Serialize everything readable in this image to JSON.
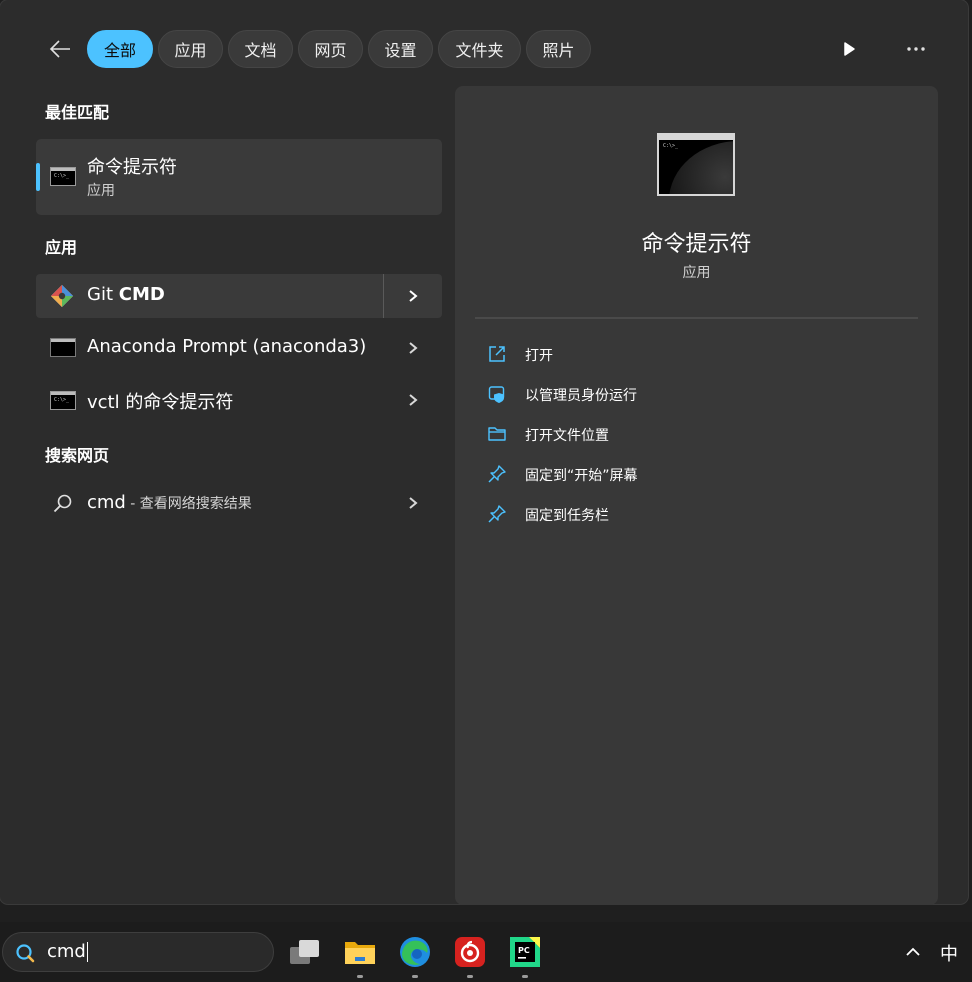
{
  "tabs": [
    {
      "label": "全部",
      "active": true
    },
    {
      "label": "应用"
    },
    {
      "label": "文档"
    },
    {
      "label": "网页"
    },
    {
      "label": "设置"
    },
    {
      "label": "文件夹"
    },
    {
      "label": "照片"
    }
  ],
  "sections": {
    "best_match": "最佳匹配",
    "apps": "应用",
    "web": "搜索网页"
  },
  "best_match": {
    "title": "命令提示符",
    "subtitle": "应用",
    "icon": "cmd-icon"
  },
  "apps": [
    {
      "name_regular": "Git ",
      "name_bold": "CMD",
      "icon": "git-icon"
    },
    {
      "name_regular": "Anaconda Prompt (anaconda3)",
      "icon": "anaconda-prompt-icon"
    },
    {
      "name_regular": "vctl 的命令提示符",
      "icon": "cmd-icon"
    }
  ],
  "web_search": {
    "query": "cmd",
    "suffix": " - 查看网络搜索结果",
    "icon": "search-icon"
  },
  "detail": {
    "title": "命令提示符",
    "subtitle": "应用",
    "actions": [
      {
        "label": "打开",
        "icon": "open-external-icon"
      },
      {
        "label": "以管理员身份运行",
        "icon": "admin-shield-icon"
      },
      {
        "label": "打开文件位置",
        "icon": "folder-icon"
      },
      {
        "label": "固定到“开始”屏幕",
        "icon": "pin-icon"
      },
      {
        "label": "固定到任务栏",
        "icon": "pin-icon"
      }
    ]
  },
  "taskbar": {
    "search_value": "cmd",
    "apps": [
      "task-view-icon",
      "file-explorer-icon",
      "edge-icon",
      "netease-music-icon",
      "pycharm-icon"
    ],
    "ime_label": "中"
  },
  "colors": {
    "accent": "#4cc2ff",
    "panel": "#2c2c2c",
    "detail_panel": "#383838"
  }
}
